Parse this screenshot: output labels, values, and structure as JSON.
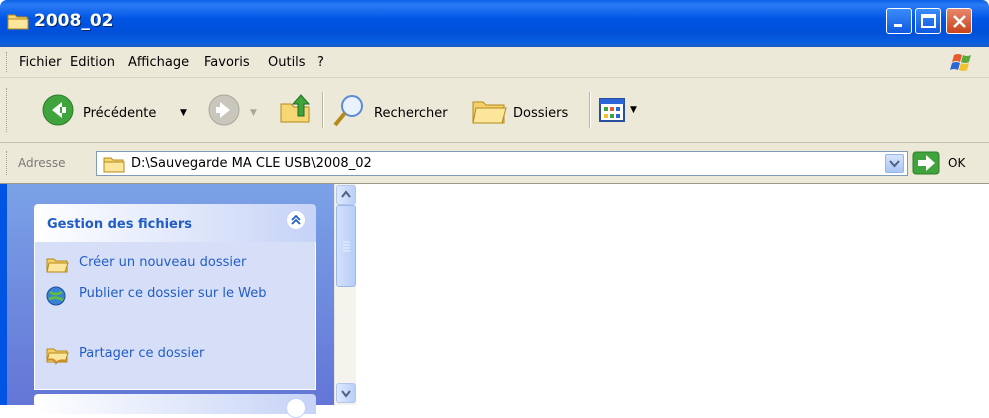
{
  "window": {
    "title": "2008_02",
    "icon": "folder-icon",
    "controls": [
      "minimize-icon",
      "maximize-icon",
      "close-icon"
    ]
  },
  "menu": {
    "items": [
      {
        "label": "Fichier"
      },
      {
        "label": "Edition"
      },
      {
        "label": "Affichage"
      },
      {
        "label": "Favoris"
      },
      {
        "label": "Outils"
      },
      {
        "label": "?"
      }
    ]
  },
  "toolbar": {
    "back_label": "Précédente",
    "search_label": "Rechercher",
    "folders_label": "Dossiers"
  },
  "address": {
    "label": "Adresse",
    "path": "D:\\Sauvegarde MA CLE USB\\2008_02",
    "go_label": "OK"
  },
  "taskpane": {
    "group_title": "Gestion des fichiers",
    "tasks": [
      {
        "label": "Créer un nouveau dossier",
        "icon": "new-folder-icon"
      },
      {
        "label": "Publier ce dossier sur le Web",
        "icon": "publish-web-icon"
      },
      {
        "label": "Partager ce dossier",
        "icon": "share-folder-icon"
      }
    ]
  },
  "colors": {
    "title_bar": "#0055e5",
    "chrome": "#ece9d8",
    "task_link": "#215dc6",
    "task_pane": "#7ba2e7"
  }
}
